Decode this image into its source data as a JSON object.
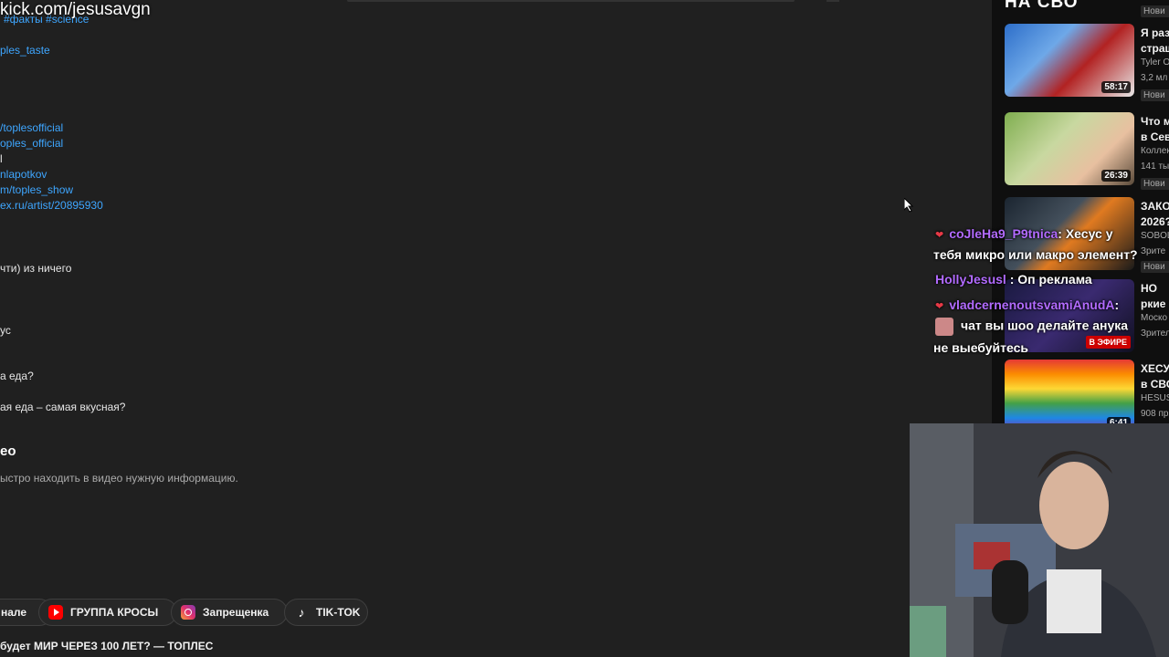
{
  "watermark": "kick.com/jesusavgn",
  "description": {
    "hashtags": "#факты #science",
    "lines": [
      {
        "text": "ples_taste",
        "kind": "link"
      },
      {
        "text": "/toplesofficial",
        "kind": "link"
      },
      {
        "text": "oples_official",
        "kind": "link"
      },
      {
        "text": "l",
        "kind": "text"
      },
      {
        "text": "nlapotkov",
        "kind": "link"
      },
      {
        "text": "m/toples_show",
        "kind": "link"
      },
      {
        "text": "ex.ru/artist/20895930",
        "kind": "link"
      },
      {
        "text": "чти) из ничего",
        "kind": "text"
      },
      {
        "text": "ус",
        "kind": "text"
      },
      {
        "text": "а еда?",
        "kind": "text"
      },
      {
        "text": "ая еда – самая вкусная?",
        "kind": "text"
      }
    ],
    "section_title": "ео",
    "section_subtitle": "ыстро находить в видео нужную информацию."
  },
  "chips": [
    {
      "label": "нале",
      "icon": ""
    },
    {
      "label": "ГРУППА КРОСЫ",
      "icon": "youtube-icon"
    },
    {
      "label": "Запрещенка",
      "icon": "instagram-icon"
    },
    {
      "label": "TIK-TOK",
      "icon": "tiktok-icon"
    }
  ],
  "bottom_title": "будет МИР ЧЕРЕЗ 100 ЛЕТ? — ТОПЛЕС",
  "sidebar": {
    "heading": "НА СВО",
    "items": [
      {
        "title_lines": [
          "Я раз",
          "страш"
        ],
        "channel": "Tyler O",
        "views": "3,2 мл",
        "badge": "Нови",
        "duration": "58:17"
      },
      {
        "title_lines": [
          "Что м",
          "в Сев"
        ],
        "channel": "Коллек",
        "views": "141 ты",
        "badge": "Нови",
        "duration": "26:39"
      },
      {
        "title_lines": [
          "ЗАКО",
          "2026?"
        ],
        "channel": "SOBOL",
        "views": "Зрите",
        "badge": "Нови",
        "duration": ""
      },
      {
        "title_lines": [
          "НО",
          "ркие"
        ],
        "channel": "Моско",
        "views": "Зрител",
        "badge": "",
        "live": "В ЭФИРЕ"
      },
      {
        "title_lines": [
          "ХЕСУ",
          "в СВО"
        ],
        "channel": "HESUS",
        "views": "908 пр",
        "badge": "",
        "duration": "6:41"
      }
    ],
    "top_badge": "Нови"
  },
  "chat": [
    {
      "user": "coJleHa9_P9tnica",
      "user_color": "#b26bff",
      "text": ": Хесус у"
    },
    {
      "user": "",
      "text": "тебя микро или макро элемент?"
    },
    {
      "user": "HollyJesusl",
      "user_color": "#b26bff",
      "text": ": Оп реклама"
    },
    {
      "user": "vladcernenoutsvamiAnudA",
      "user_color": "#b26bff",
      "text": ":"
    },
    {
      "user": "",
      "text": "чат вы шоо делайте анука"
    },
    {
      "user": "",
      "text": "не выебуйтесь"
    }
  ]
}
